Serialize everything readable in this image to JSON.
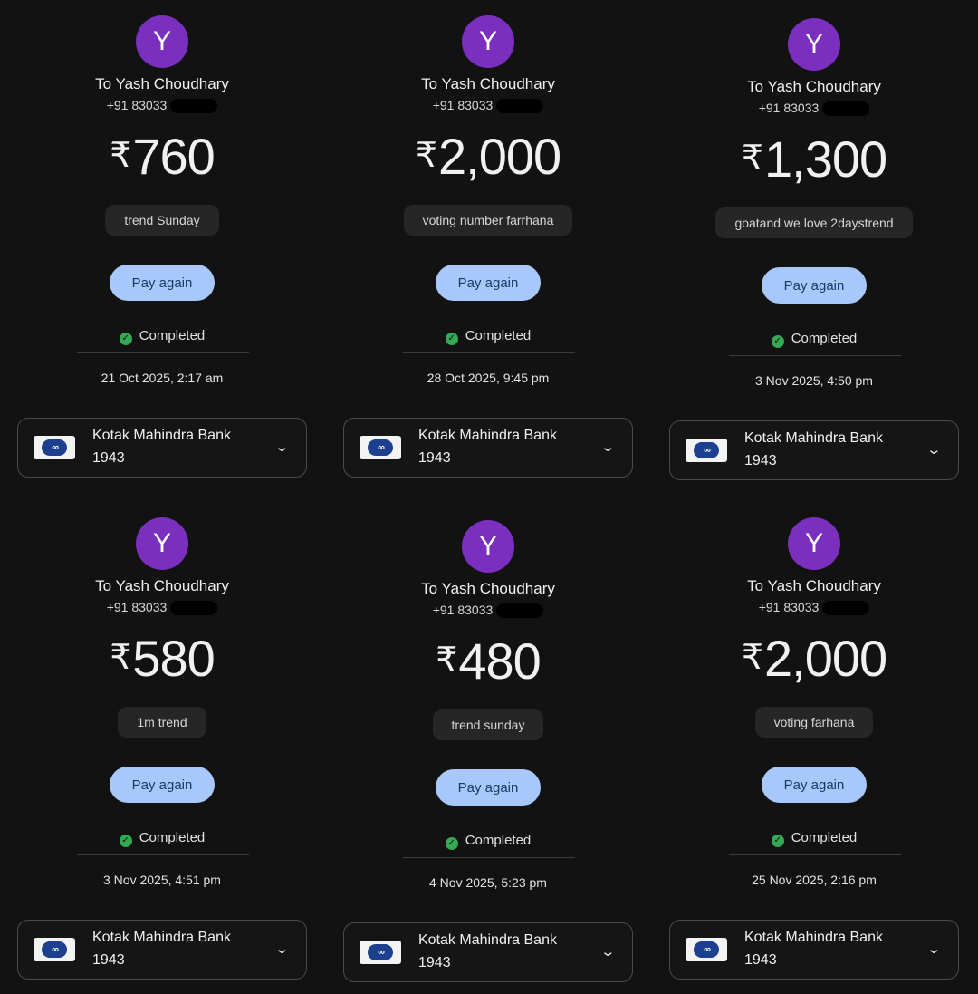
{
  "common": {
    "avatar_letter": "Y",
    "recipient": "To Yash Choudhary",
    "phone_prefix": "+91 83033",
    "currency_symbol": "₹",
    "pay_again_label": "Pay again",
    "status_label": "Completed",
    "bank_name": "Kotak Mahindra Bank",
    "bank_account": "1943",
    "accent_color": "#a8c7fa",
    "avatar_color": "#7b2fbf",
    "status_color": "#34a853"
  },
  "transactions": [
    {
      "amount": "760",
      "note": "trend Sunday",
      "date": "21 Oct 2025, 2:17 am"
    },
    {
      "amount": "2,000",
      "note": "voting number farrhana",
      "date": "28 Oct 2025, 9:45 pm"
    },
    {
      "amount": "1,300",
      "note": "goatand we love 2daystrend",
      "date": "3 Nov 2025, 4:50 pm"
    },
    {
      "amount": "580",
      "note": "1m trend",
      "date": "3 Nov 2025, 4:51 pm"
    },
    {
      "amount": "480",
      "note": "trend sunday",
      "date": "4 Nov 2025, 5:23 pm"
    },
    {
      "amount": "2,000",
      "note": "voting farhana",
      "date": "25 Nov 2025, 2:16 pm"
    }
  ]
}
